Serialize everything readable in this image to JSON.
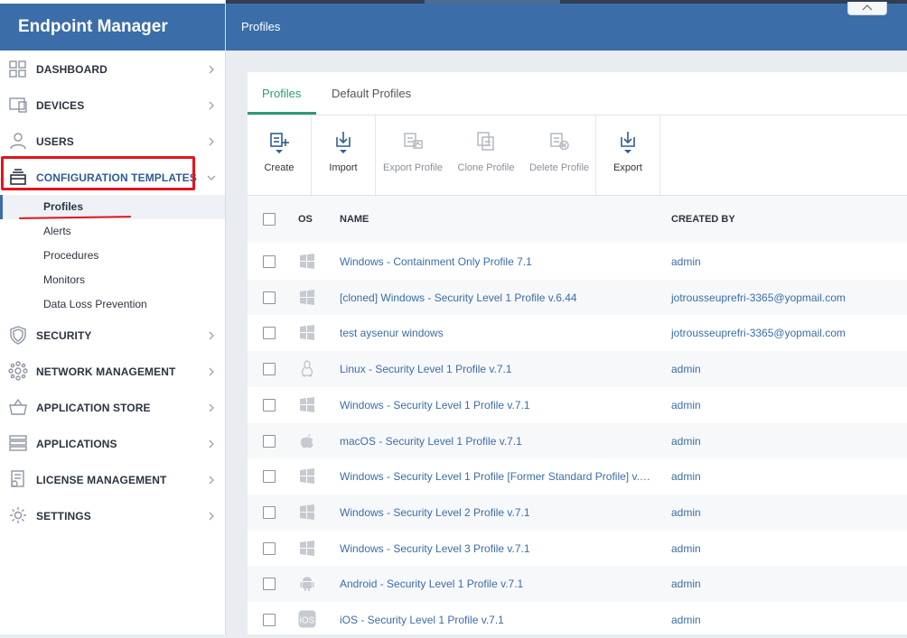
{
  "app": {
    "title": "Endpoint Manager"
  },
  "header": {
    "title": "Profiles"
  },
  "nav": {
    "dashboard": "DASHBOARD",
    "devices": "DEVICES",
    "users": "USERS",
    "configuration_templates": "CONFIGURATION TEMPLATES",
    "security": "SECURITY",
    "network_management": "NETWORK MANAGEMENT",
    "application_store": "APPLICATION STORE",
    "applications": "APPLICATIONS",
    "license_management": "LICENSE MANAGEMENT",
    "settings": "SETTINGS"
  },
  "subnav": {
    "profiles": "Profiles",
    "alerts": "Alerts",
    "procedures": "Procedures",
    "monitors": "Monitors",
    "dlp": "Data Loss Prevention"
  },
  "tabs": {
    "profiles": "Profiles",
    "default_profiles": "Default Profiles"
  },
  "toolbar": {
    "create": "Create",
    "import": "Import",
    "export_profile": "Export Profile",
    "clone_profile": "Clone Profile",
    "delete_profile": "Delete Profile",
    "export": "Export"
  },
  "table": {
    "headers": {
      "os": "OS",
      "name": "NAME",
      "created_by": "CREATED BY"
    },
    "rows": [
      {
        "os": "windows",
        "name": "Windows - Containment Only Profile 7.1",
        "created_by": "admin"
      },
      {
        "os": "windows",
        "name": "[cloned] Windows - Security Level 1 Profile v.6.44",
        "created_by": "jotrousseuprefri-3365@yopmail.com"
      },
      {
        "os": "windows",
        "name": "test aysenur windows",
        "created_by": "jotrousseuprefri-3365@yopmail.com"
      },
      {
        "os": "linux",
        "name": "Linux - Security Level 1 Profile v.7.1",
        "created_by": "admin"
      },
      {
        "os": "windows",
        "name": "Windows - Security Level 1 Profile v.7.1",
        "created_by": "admin"
      },
      {
        "os": "apple",
        "name": "macOS - Security Level 1 Profile v.7.1",
        "created_by": "admin"
      },
      {
        "os": "windows",
        "name": "Windows - Security Level 1 Profile [Former Standard Profile] v.7…",
        "created_by": "admin"
      },
      {
        "os": "windows",
        "name": "Windows - Security Level 2 Profile v.7.1",
        "created_by": "admin"
      },
      {
        "os": "windows",
        "name": "Windows - Security Level 3 Profile v.7.1",
        "created_by": "admin"
      },
      {
        "os": "android",
        "name": "Android - Security Level 1 Profile v.7.1",
        "created_by": "admin"
      },
      {
        "os": "ios",
        "name": "iOS - Security Level 1 Profile v.7.1",
        "created_by": "admin"
      }
    ]
  },
  "colors": {
    "brand_blue": "#3b6da8",
    "accent_green": "#2d9c6f",
    "highlight_red": "#e3141c",
    "link_blue": "#3b6da8"
  }
}
